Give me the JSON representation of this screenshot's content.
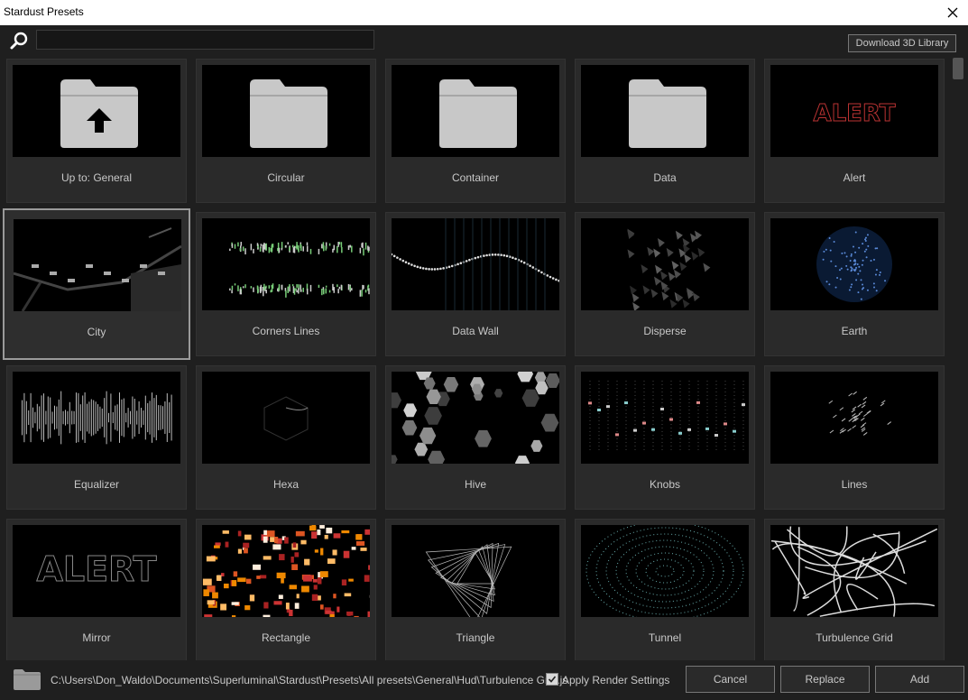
{
  "window": {
    "title": "Stardust Presets"
  },
  "toolbar": {
    "search_value": "",
    "download_label": "Download 3D Library"
  },
  "tiles": [
    {
      "label": "Up to: General",
      "icon": "folder-up-icon"
    },
    {
      "label": "Circular",
      "icon": "folder-icon"
    },
    {
      "label": "Container",
      "icon": "folder-icon"
    },
    {
      "label": "Data",
      "icon": "folder-icon"
    },
    {
      "label": "Alert",
      "icon": "preset-thumbnail",
      "thumb_text": "ALERT"
    },
    {
      "label": "City",
      "icon": "preset-thumbnail",
      "selected": true
    },
    {
      "label": "Corners Lines",
      "icon": "preset-thumbnail"
    },
    {
      "label": "Data Wall",
      "icon": "preset-thumbnail"
    },
    {
      "label": "Disperse",
      "icon": "preset-thumbnail"
    },
    {
      "label": "Earth",
      "icon": "preset-thumbnail"
    },
    {
      "label": "Equalizer",
      "icon": "preset-thumbnail"
    },
    {
      "label": "Hexa",
      "icon": "preset-thumbnail"
    },
    {
      "label": "Hive",
      "icon": "preset-thumbnail"
    },
    {
      "label": "Knobs",
      "icon": "preset-thumbnail"
    },
    {
      "label": "Lines",
      "icon": "preset-thumbnail"
    },
    {
      "label": "Mirror",
      "icon": "preset-thumbnail",
      "thumb_text": "ALERT"
    },
    {
      "label": "Rectangle",
      "icon": "preset-thumbnail"
    },
    {
      "label": "Triangle",
      "icon": "preset-thumbnail"
    },
    {
      "label": "Tunnel",
      "icon": "preset-thumbnail"
    },
    {
      "label": "Turbulence Grid",
      "icon": "preset-thumbnail"
    }
  ],
  "footer": {
    "path": "C:\\Users\\Don_Waldo\\Documents\\Superluminal\\Stardust\\Presets\\All presets\\General\\Hud\\Turbulence Grid.js",
    "apply_render_label": "Apply Render Settings",
    "apply_render_checked": true,
    "cancel_label": "Cancel",
    "replace_label": "Replace",
    "add_label": "Add"
  },
  "colors": {
    "background": "#1f1f1f",
    "tile": "#2a2a2a",
    "thumb": "#000000",
    "text": "#c8c8c8"
  }
}
